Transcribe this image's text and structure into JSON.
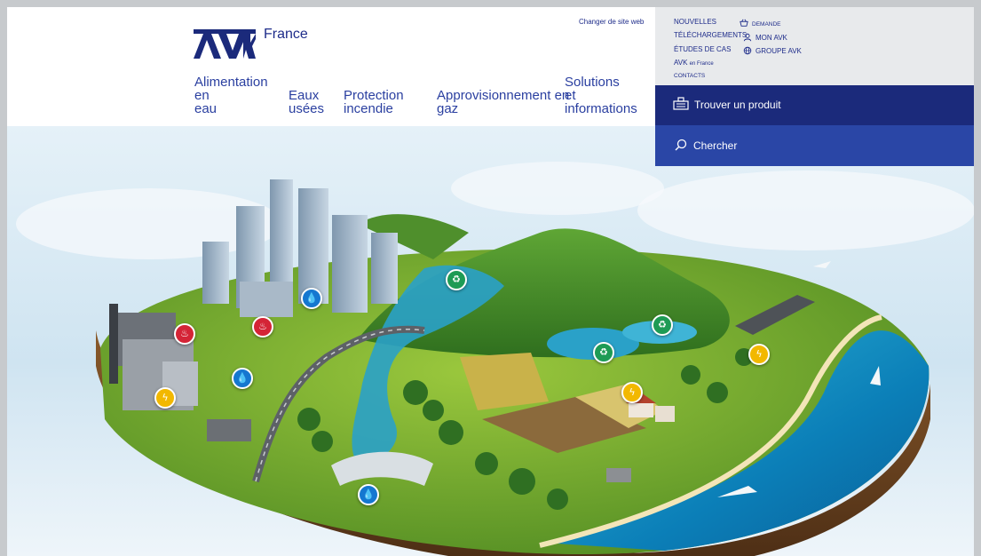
{
  "header": {
    "country": "France",
    "change_site": "Changer de site web",
    "nav": [
      {
        "line1": "Alimentation en",
        "line2": "eau"
      },
      {
        "line1": "Eaux",
        "line2": "usées"
      },
      {
        "line1": "Protection",
        "line2": "incendie"
      },
      {
        "line1": "Approvisionnement en",
        "line2": "gaz"
      },
      {
        "line1": "Solutions",
        "line2": "et",
        "line3": "informations"
      }
    ]
  },
  "utility": {
    "news": "NOUVELLES",
    "downloads": "TÉLÉCHARGEMENTS",
    "case_studies": "ÉTUDES DE CAS",
    "avk_local_a": "AVK",
    "avk_local_b": "en France",
    "contacts": "CONTACTS",
    "request": "DEMANDE",
    "my_avk": "MON AVK",
    "group": "GROUPE AVK"
  },
  "find_product": "Trouver un produit",
  "search": {
    "label": "Chercher"
  },
  "markers": [
    {
      "type": "fire"
    },
    {
      "type": "fire"
    },
    {
      "type": "water"
    },
    {
      "type": "water"
    },
    {
      "type": "water"
    },
    {
      "type": "waste"
    },
    {
      "type": "waste"
    },
    {
      "type": "waste"
    },
    {
      "type": "gas"
    },
    {
      "type": "gas"
    },
    {
      "type": "gas"
    }
  ],
  "colors": {
    "brand": "#1b2a7b",
    "search": "#2a46a6",
    "link": "#1e2c8a",
    "water": "#1577d0",
    "fire": "#d42436",
    "waste": "#1e9b55",
    "gas": "#f2b800"
  }
}
